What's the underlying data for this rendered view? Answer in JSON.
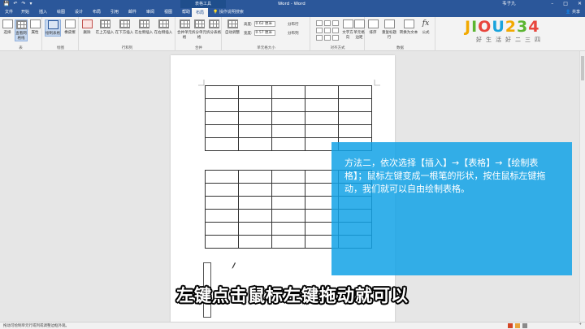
{
  "titlebar": {
    "quick_access": [
      "💾",
      "↶",
      "↷",
      "▾"
    ],
    "context_tools": "表格工具",
    "title": "Word  -  Word",
    "user": "韦子九",
    "window_controls": [
      "–",
      "□",
      "✕"
    ]
  },
  "tabs": [
    {
      "label": "文件"
    },
    {
      "label": "开始"
    },
    {
      "label": "插入"
    },
    {
      "label": "绘图"
    },
    {
      "label": "设计"
    },
    {
      "label": "布局"
    },
    {
      "label": "引用"
    },
    {
      "label": "邮件"
    },
    {
      "label": "审阅"
    },
    {
      "label": "视图"
    },
    {
      "label": "帮助"
    },
    {
      "label": "设计"
    },
    {
      "label": "布局"
    }
  ],
  "tell_me": "操作说明搜索",
  "share": "共享",
  "ribbon": {
    "table_group": {
      "buttons": [
        "选择",
        "查看网格线",
        "属性"
      ],
      "label": "表"
    },
    "draw_group": {
      "buttons": [
        "绘制表格",
        "橡皮擦"
      ],
      "label": "绘图"
    },
    "rows_cols_group": {
      "buttons": [
        "删除",
        "在上方插入",
        "在下方插入",
        "在左侧插入",
        "在右侧插入"
      ],
      "label": "行和列"
    },
    "merge_group": {
      "buttons": [
        "合并单元格",
        "拆分单元格",
        "拆分表格"
      ],
      "label": "合并"
    },
    "cellsize_group": {
      "autofit": "自动调整",
      "height_label": "高度:",
      "height_value": "0.62 厘米",
      "width_label": "宽度:",
      "width_value": "0.57 厘米",
      "dist_rows": "分布行",
      "dist_cols": "分布列",
      "label": "单元格大小"
    },
    "align_group": {
      "buttons": [
        "文字方向",
        "单元格边距"
      ],
      "label": "对齐方式"
    },
    "data_group": {
      "buttons": [
        "排序",
        "重复标题行",
        "转换为文本",
        "公式"
      ],
      "label": "数据"
    }
  },
  "logo": {
    "word": [
      "J",
      "I",
      "O",
      "U",
      "2",
      "3",
      "4"
    ],
    "slogan": "好生活好二三四"
  },
  "tip_text": "方法二，依次选择【插入】→【表格】→【绘制表格】；鼠标左键变成一根笔的形状，按住鼠标左键拖动，我们就可以自由绘制表格。",
  "subtitle": "左键点击鼠标左键拖动就可以",
  "statusbar": {
    "message": "拖动可绘制单元行或列或调整边框外观。",
    "zoom": "+"
  },
  "colors": {
    "accent": "#2b579a",
    "tip_bg": "#12a2e6"
  }
}
